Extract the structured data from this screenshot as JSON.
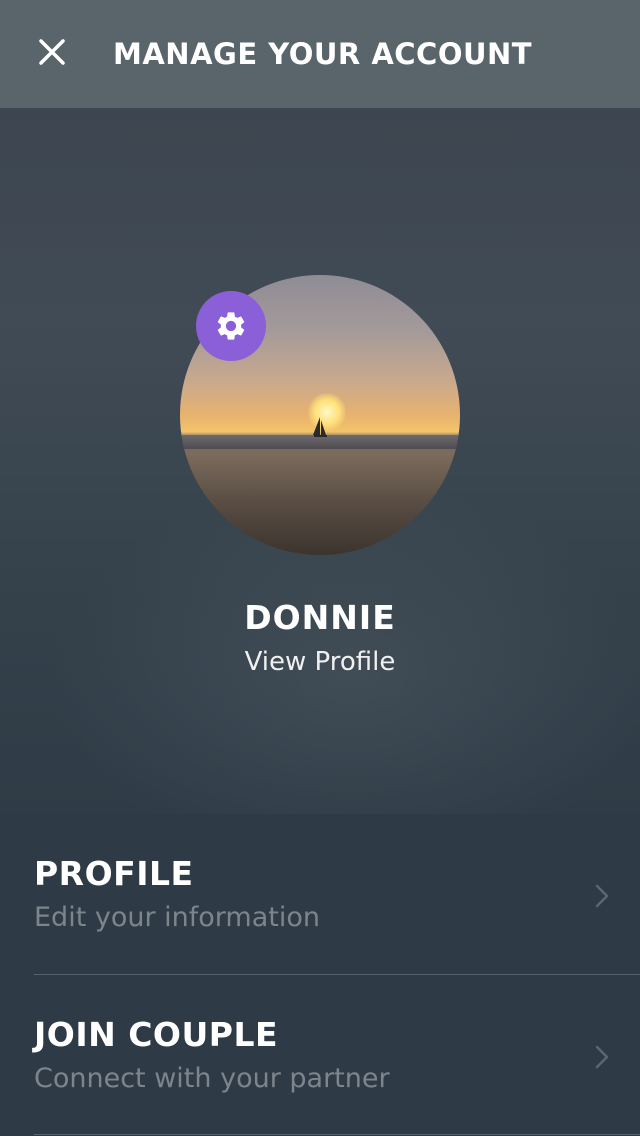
{
  "header": {
    "title": "MANAGE YOUR ACCOUNT",
    "close_icon": "close-icon"
  },
  "profile": {
    "name": "DONNIE",
    "view_profile_label": "View Profile",
    "settings_icon": "gear-icon",
    "badge_color": "#8a5fd8"
  },
  "menu": {
    "items": [
      {
        "label": "PROFILE",
        "description": "Edit your information",
        "icon": "chevron-right-icon"
      },
      {
        "label": "JOIN COUPLE",
        "description": "Connect with your partner",
        "icon": "chevron-right-icon"
      }
    ]
  }
}
